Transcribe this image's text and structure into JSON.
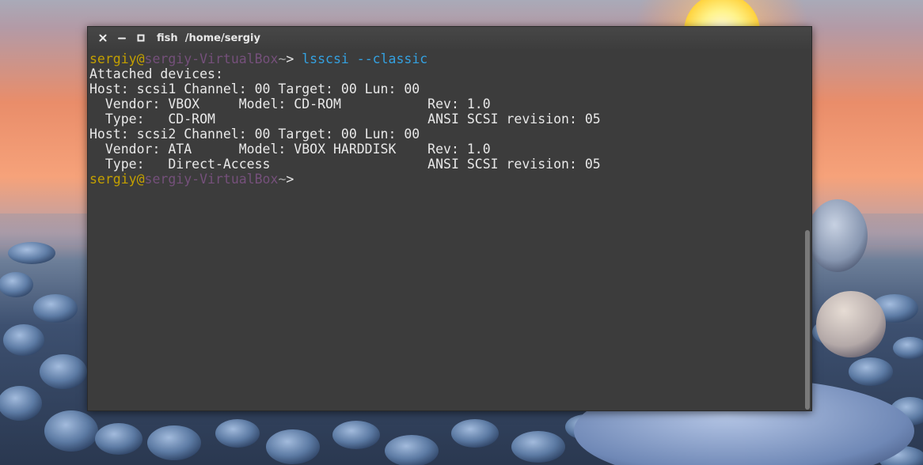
{
  "window": {
    "title_app": "fish",
    "title_path": "/home/sergiy"
  },
  "terminal": {
    "prompt1": {
      "user": "sergiy",
      "at": "@",
      "host": "sergiy-VirtualBox",
      "cwd": "~",
      "symbol": "> ",
      "command": "lsscsi",
      "space": " ",
      "argument": "--classic"
    },
    "output": [
      "Attached devices:",
      "Host: scsi1 Channel: 00 Target: 00 Lun: 00",
      "  Vendor: VBOX     Model: CD-ROM           Rev: 1.0",
      "  Type:   CD-ROM                           ANSI SCSI revision: 05",
      "Host: scsi2 Channel: 00 Target: 00 Lun: 00",
      "  Vendor: ATA      Model: VBOX HARDDISK    Rev: 1.0",
      "  Type:   Direct-Access                    ANSI SCSI revision: 05"
    ],
    "prompt2": {
      "user": "sergiy",
      "at": "@",
      "host": "sergiy-VirtualBox",
      "cwd": "~",
      "symbol": ">"
    }
  },
  "icons": {
    "close": "close-icon",
    "minimize": "minimize-icon",
    "maximize": "maximize-icon"
  },
  "colors": {
    "terminal_bg": "#3c3c3c",
    "user": "#c4a000",
    "host": "#75507b",
    "command": "#34a1e0",
    "text": "#e8e8e8"
  }
}
